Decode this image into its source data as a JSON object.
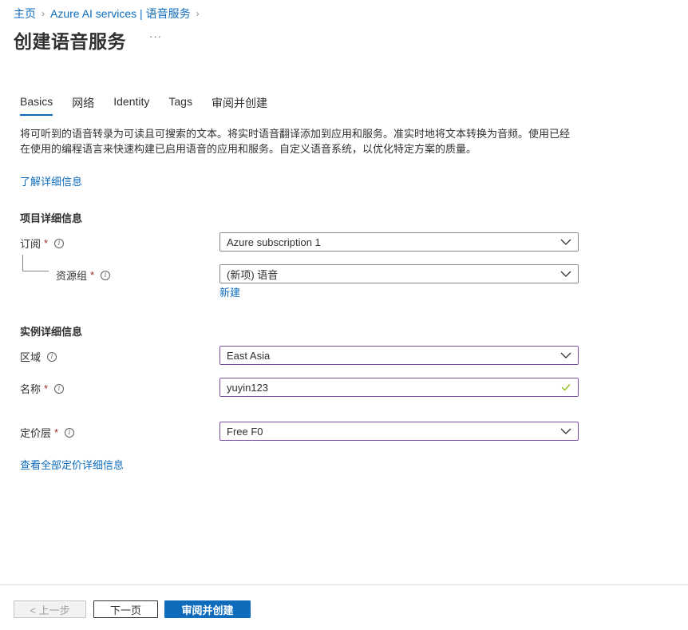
{
  "breadcrumb": {
    "items": [
      "主页",
      "Azure AI services | 语音服务"
    ]
  },
  "header": {
    "title": "创建语音服务",
    "more": "···"
  },
  "tabs": [
    {
      "label": "Basics",
      "active": true
    },
    {
      "label": "网络"
    },
    {
      "label": "Identity"
    },
    {
      "label": "Tags"
    },
    {
      "label": "审阅并创建"
    }
  ],
  "description": {
    "line1": "将可听到的语音转录为可读且可搜索的文本。将实时语音翻译添加到应用和服务。准实时地将文本转换为音频。使用已经",
    "line2": "在使用的编程语言来快速构建已启用语音的应用和服务。自定义语音系统，以优化特定方案的质量。",
    "learn_more": "了解详细信息"
  },
  "project_details": {
    "title": "项目详细信息",
    "subscription": {
      "label": "订阅",
      "required": "*",
      "value": "Azure subscription 1"
    },
    "resource_group": {
      "label": "资源组",
      "required": "*",
      "value": "(新项) 语音",
      "new_link": "新建"
    }
  },
  "instance_details": {
    "title": "实例详细信息",
    "region": {
      "label": "区域",
      "value": "East Asia"
    },
    "name": {
      "label": "名称",
      "required": "*",
      "value": "yuyin123"
    },
    "pricing_tier": {
      "label": "定价层",
      "required": "*",
      "value": "Free F0"
    },
    "pricing_link": "查看全部定价详细信息"
  },
  "footer": {
    "prev": "< 上一步",
    "next": "下一页",
    "review_create": "审阅并创建"
  },
  "colors": {
    "accent": "#0f6cbd",
    "focus_border": "#7b4fa3",
    "required": "#a4262c",
    "valid_check": "#8cbd18"
  }
}
